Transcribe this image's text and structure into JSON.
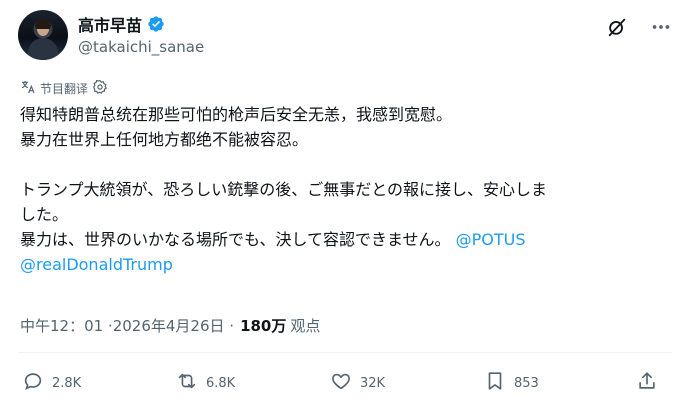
{
  "author": {
    "display_name": "高市早苗",
    "handle": "@takaichi_sanae"
  },
  "translation": {
    "label": "节目翻译"
  },
  "post": {
    "lines": [
      "得知特朗普总统在那些可怕的枪声后安全无恙，我感到宽慰。",
      "暴力在世界上任何地方都绝不能被容忍。",
      "トランプ大統領が、恐ろしい銃撃の後、ご無事だとの報に接し、安心しま",
      "した。",
      "暴力は、世界のいかなる場所でも、決して容認できません。"
    ],
    "mention_1": "@POTUS",
    "mention_2": "@realDonaldTrump"
  },
  "meta": {
    "timestamp": "中午12：01 ·2026年4月26日 ·",
    "views_count": "180万",
    "views_label": "观点"
  },
  "actions": {
    "replies": "2.8K",
    "reposts": "6.8K",
    "likes": "32K",
    "bookmarks": "853"
  },
  "colors": {
    "text": "#0f1419",
    "secondary": "#536471",
    "accent": "#1d9bf0"
  },
  "icons": [
    "verified-badge-icon",
    "grok-icon",
    "more-icon",
    "translate-icon",
    "settings-icon",
    "reply-icon",
    "repost-icon",
    "like-icon",
    "bookmark-icon",
    "share-icon"
  ]
}
